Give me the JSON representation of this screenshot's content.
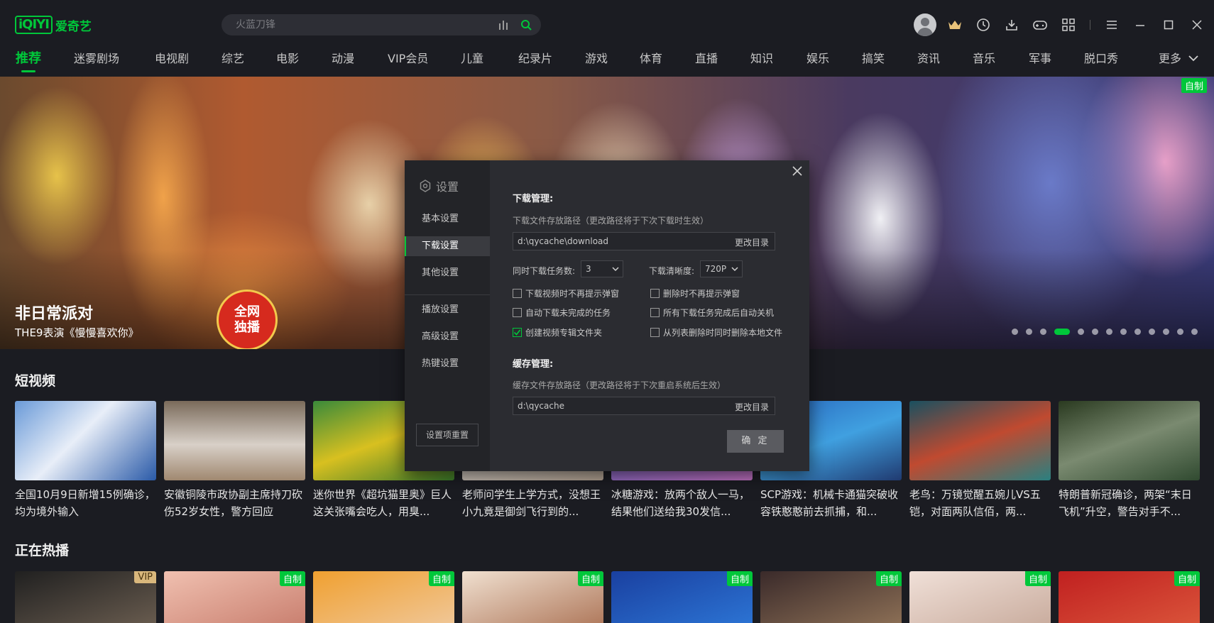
{
  "app": {
    "logo_mark": "iQIYI",
    "logo_text": "爱奇艺"
  },
  "search": {
    "placeholder": "火蓝刀锋"
  },
  "toolbar": {
    "icons": [
      "avatar",
      "vip-crown-icon",
      "history-icon",
      "download-icon",
      "game-icon",
      "apps-grid-icon",
      "menu-icon",
      "minimize-icon",
      "maximize-icon",
      "close-icon"
    ]
  },
  "nav": {
    "items": [
      "推荐",
      "迷雾剧场",
      "电视剧",
      "综艺",
      "电影",
      "动漫",
      "VIP会员",
      "儿童",
      "纪录片",
      "游戏",
      "体育",
      "直播",
      "知识",
      "娱乐",
      "搞笑",
      "资讯",
      "音乐",
      "军事",
      "脱口秀"
    ],
    "active": "推荐",
    "more": "更多"
  },
  "banner": {
    "badge": "自制",
    "title": "非日常派对",
    "subtitle": "THE9表演《慢慢喜欢你》",
    "logo_line1": "全网",
    "logo_line2": "独播",
    "dot_count": 13,
    "active_dot": 3
  },
  "short_videos": {
    "title": "短视频",
    "items": [
      {
        "caption": "全国10月9日新增15例确诊，均为境外输入"
      },
      {
        "caption": "安徽铜陵市政协副主席持刀砍伤52岁女性，警方回应"
      },
      {
        "caption": "迷你世界《超坑猫里奥》巨人这关张嘴会吃人，用臭..."
      },
      {
        "caption": "老师问学生上学方式，没想王小九竟是御剑飞行到的..."
      },
      {
        "caption": "冰糖游戏：放两个敌人一马，结果他们送给我30发信..."
      },
      {
        "caption": "SCP游戏：机械卡通猫突破收容铁憨憨前去抓捕，和..."
      },
      {
        "caption": "老鸟：万镜觉醒五婉儿VS五铠，对面两队信佰，两..."
      },
      {
        "caption": "特朗普新冠确诊，两架“末日飞机”升空，警告对手不..."
      }
    ]
  },
  "hot": {
    "title": "正在热播",
    "tags": [
      "VIP",
      "自制",
      "自制",
      "自制",
      "自制",
      "自制",
      "自制",
      "自制"
    ]
  },
  "settings": {
    "title": "设置",
    "menu": [
      "基本设置",
      "下载设置",
      "其他设置",
      "播放设置",
      "高级设置",
      "热键设置"
    ],
    "active_menu": "下载设置",
    "reset_label": "设置项重置",
    "download": {
      "heading": "下载管理:",
      "path_label": "下载文件存放路径（更改路径将于下次下载时生效）",
      "path_value": "d:\\qycache\\download",
      "change_dir": "更改目录",
      "concurrent_label": "同时下载任务数:",
      "concurrent_value": "3",
      "quality_label": "下载清晰度:",
      "quality_value": "720P",
      "options": [
        {
          "label": "下载视频时不再提示弹窗",
          "checked": false
        },
        {
          "label": "删除时不再提示弹窗",
          "checked": false
        },
        {
          "label": "自动下载未完成的任务",
          "checked": false
        },
        {
          "label": "所有下载任务完成后自动关机",
          "checked": false
        },
        {
          "label": "创建视频专辑文件夹",
          "checked": true
        },
        {
          "label": "从列表删除时同时删除本地文件",
          "checked": false
        }
      ]
    },
    "cache": {
      "heading": "缓存管理:",
      "path_label": "缓存文件存放路径（更改路径将于下次重启系统后生效）",
      "path_value": "d:\\qycache",
      "change_dir": "更改目录"
    },
    "ok_label": "确 定"
  },
  "colors": {
    "accent": "#00c73a",
    "background": "#1b1c22",
    "modal": "#2b2c31"
  }
}
